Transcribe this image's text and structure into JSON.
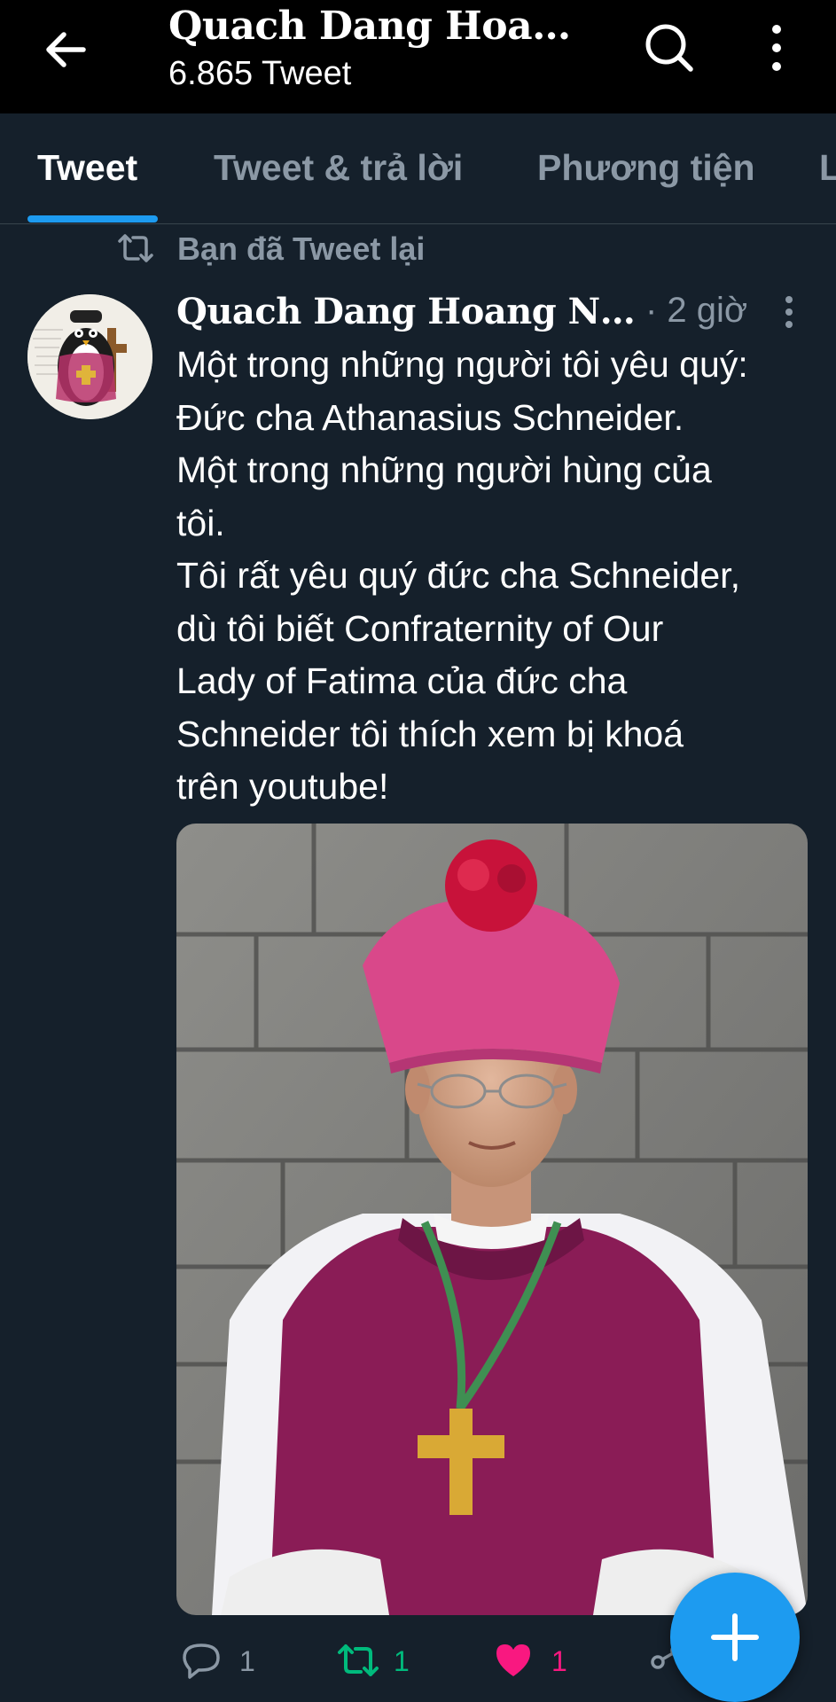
{
  "header": {
    "title": "Quach Dang Hoan...",
    "subtitle": "6.865 Tweet"
  },
  "tabs": [
    {
      "label": "Tweet",
      "active": true
    },
    {
      "label": "Tweet & trả lời",
      "active": false
    },
    {
      "label": "Phương tiện",
      "active": false
    },
    {
      "label": "L",
      "active": false
    }
  ],
  "tweet": {
    "retweet_note": "Bạn đã Tweet lại",
    "author": "Quach Dang Hoang Ngan...",
    "time": "· 2 giờ",
    "text": "Một trong những người tôi yêu quý:\nĐức cha Athanasius Schneider.\nMột trong những người hùng của\ntôi.\nTôi rất yêu quý đức cha Schneider,\ndù tôi biết Confraternity of Our\nLady of Fatima của đức cha\nSchneider  tôi thích xem bị khoá\ntrên youtube!",
    "counts": {
      "replies": "1",
      "retweets": "1",
      "likes": "1"
    }
  },
  "colors": {
    "background": "#15202b",
    "topbar": "#000000",
    "accent": "#1d9bf0",
    "retweet_green": "#00ba7c",
    "like_pink": "#f91880",
    "muted_text": "#8b98a5"
  },
  "icons": {
    "back": "arrow-left-icon",
    "search": "search-icon",
    "more": "more-vertical-icon",
    "retweet": "retweet-icon",
    "reply": "reply-icon",
    "like": "heart-icon",
    "share": "share-icon",
    "compose": "plus-icon"
  }
}
